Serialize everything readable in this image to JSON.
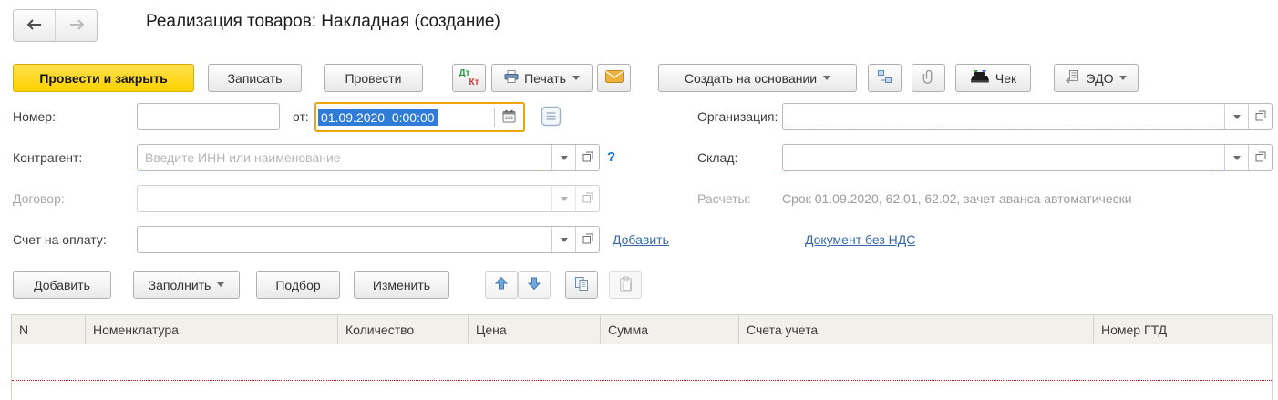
{
  "window": {
    "title": "Реализация товаров: Накладная (создание)"
  },
  "toolbar": {
    "post_and_close": "Провести и закрыть",
    "save": "Записать",
    "post": "Провести",
    "dt": "Дт",
    "kt": "Кт",
    "print": "Печать",
    "create_based_on": "Создать на основании",
    "receipt": "Чек",
    "edo": "ЭДО"
  },
  "form": {
    "number_label": "Номер:",
    "number_value": "",
    "date_label": "от:",
    "date_value": "01.09.2020  0:00:00",
    "organization_label": "Организация:",
    "counterparty_label": "Контрагент:",
    "counterparty_placeholder": "Введите ИНН или наименование",
    "help": "?",
    "warehouse_label": "Склад:",
    "contract_label": "Договор:",
    "settlements_label": "Расчеты:",
    "settlements_value": "Срок 01.09.2020, 62.01, 62.02, зачет аванса автоматически",
    "invoice_label": "Счет на оплату:",
    "add_invoice_link": "Добавить",
    "no_vat_link": "Документ без НДС"
  },
  "items_toolbar": {
    "add": "Добавить",
    "fill": "Заполнить",
    "pick": "Подбор",
    "edit": "Изменить"
  },
  "table": {
    "columns": [
      "N",
      "Номенклатура",
      "Количество",
      "Цена",
      "Сумма",
      "Счета учета",
      "Номер ГТД"
    ]
  },
  "colors": {
    "primary_button": "#ffd600",
    "focus_border": "#efa50a",
    "required_underline": "#cc0000",
    "selection_bg": "#2f7cd8",
    "link": "#3468a8"
  }
}
